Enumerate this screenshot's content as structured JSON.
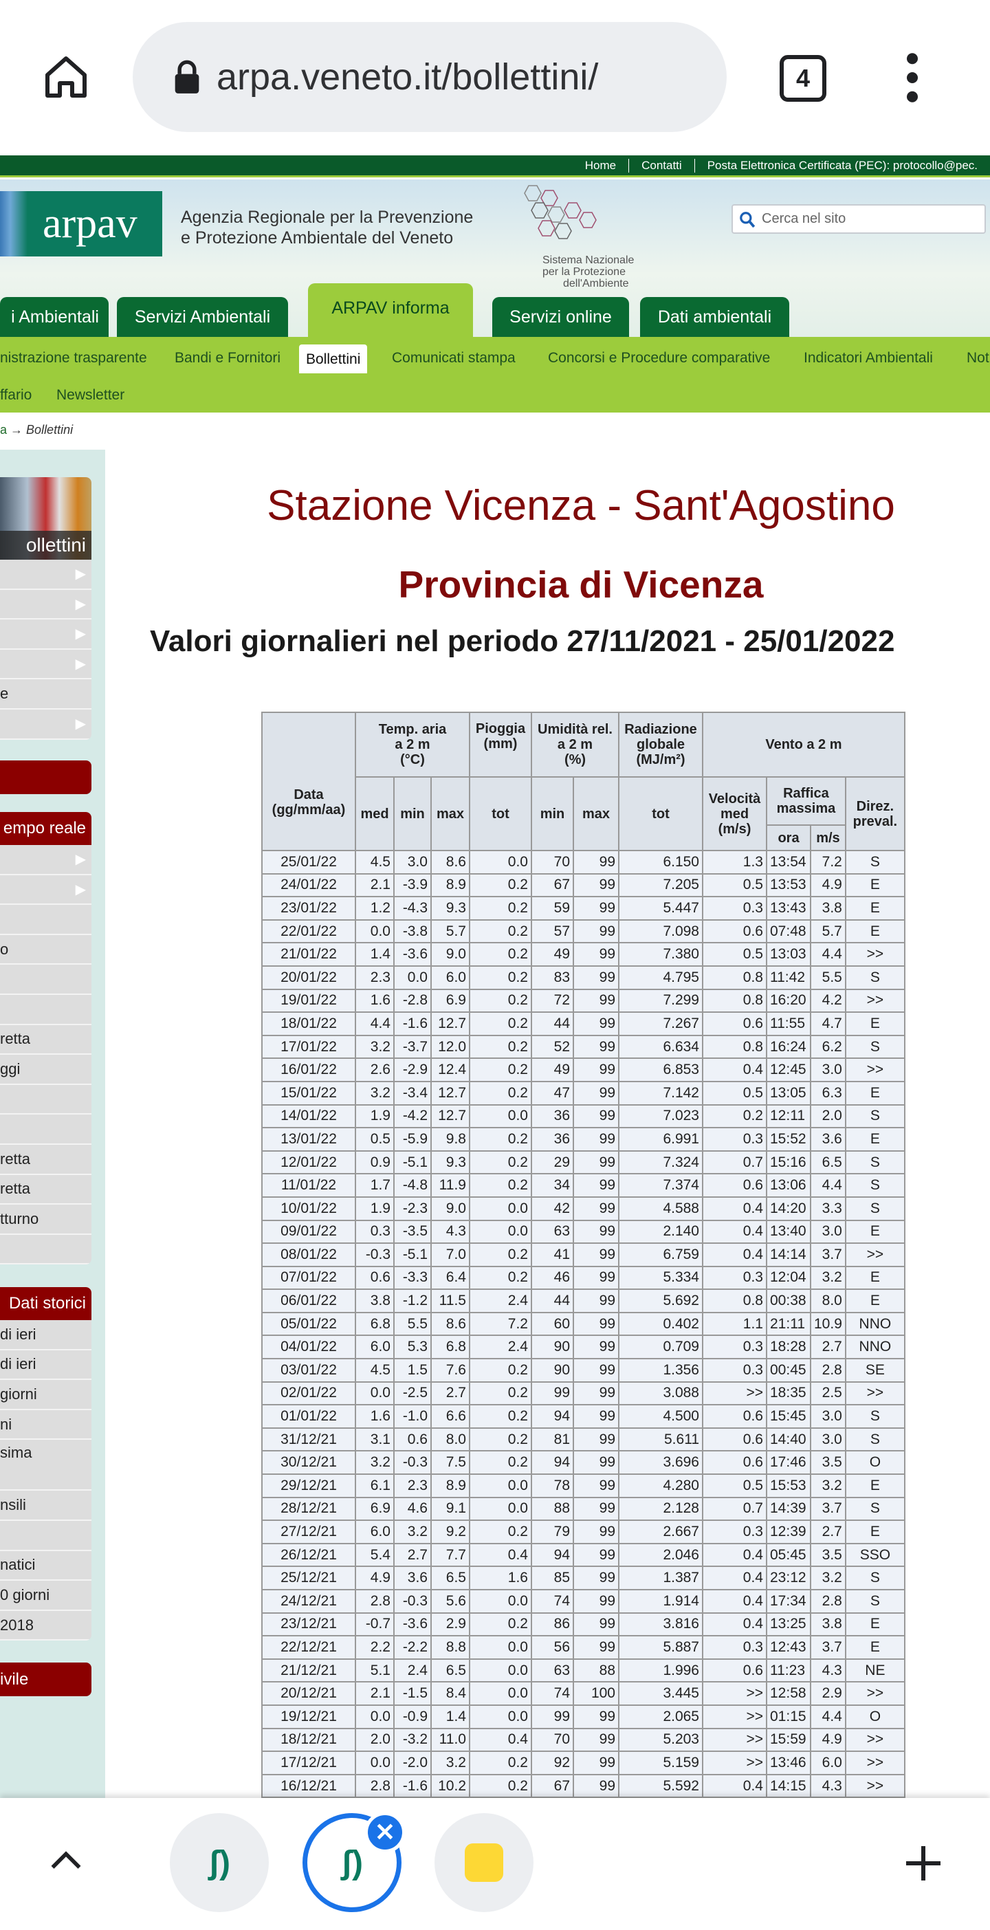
{
  "browser": {
    "url": "arpa.veneto.it/bollettini/",
    "tab_count": "4"
  },
  "topbar": {
    "links": [
      "Home",
      "Contatti",
      "Posta Elettronica Certificata (PEC): protocollo@pec."
    ]
  },
  "header": {
    "logo_text": "arpav",
    "agency_line1": "Agenzia Regionale per la Prevenzione",
    "agency_line2": "e Protezione Ambientale del Veneto",
    "snpa_line1": "Sistema Nazionale",
    "snpa_line2": "per la Protezione",
    "snpa_line3": "dell'Ambiente",
    "search_placeholder": "Cerca nel sito"
  },
  "tabs": [
    "i Ambientali",
    "Servizi Ambientali",
    "ARPAV informa",
    "Servizi online",
    "Dati ambientali"
  ],
  "subnav": {
    "row1": [
      "nistrazione trasparente",
      "Bandi e Fornitori",
      "Bollettini",
      "Comunicati stampa",
      "Concorsi e Procedure comparative",
      "Indicatori Ambientali",
      "Not"
    ],
    "row2": [
      "ffario",
      "Newsletter"
    ]
  },
  "breadcrumb": {
    "current": "Bollettini"
  },
  "sidebar": {
    "box1_title": "ollettini",
    "box1_items": [
      "",
      "",
      "",
      "",
      "e",
      ""
    ],
    "box2_title": "empo reale",
    "box2_items": [
      "",
      "",
      "",
      "o",
      "",
      "",
      "retta",
      "ggi",
      "",
      "",
      "retta",
      "retta",
      "tturno",
      ""
    ],
    "box3_title": "Dati storici",
    "box3_items": [
      "di ieri",
      "di ieri",
      "giorni",
      "ni",
      "sima",
      "nsili",
      "",
      "natici",
      "0 giorni",
      "2018"
    ],
    "box4_title": "ivile"
  },
  "main": {
    "title": "Stazione Vicenza - Sant'Agostino",
    "subtitle": "Provincia di Vicenza",
    "period": "Valori giornalieri nel periodo 27/11/2021 - 25/01/2022"
  },
  "table": {
    "headers": {
      "data": "Data",
      "data_unit": "(gg/mm/aa)",
      "temp": "Temp. aria",
      "temp2": "a 2 m",
      "temp3": "(°C)",
      "rain": "Pioggia",
      "rain2": "(mm)",
      "hum": "Umidità rel.",
      "hum2": "a 2 m",
      "hum3": "(%)",
      "rad": "Radiazione",
      "rad2": "globale",
      "rad3": "(MJ/m²)",
      "wind": "Vento a 2 m",
      "med": "med",
      "min": "min",
      "max": "max",
      "tot": "tot",
      "vel": "Velocità",
      "vel2": "med",
      "vel3": "(m/s)",
      "gust": "Raffica",
      "gust2": "massima",
      "ora": "ora",
      "ms": "m/s",
      "dir": "Direz.",
      "dir2": "preval."
    },
    "rows": [
      [
        "25/01/22",
        "4.5",
        "3.0",
        "8.6",
        "0.0",
        "70",
        "99",
        "6.150",
        "1.3",
        "13:54",
        "7.2",
        "S"
      ],
      [
        "24/01/22",
        "2.1",
        "-3.9",
        "8.9",
        "0.2",
        "67",
        "99",
        "7.205",
        "0.5",
        "13:53",
        "4.9",
        "E"
      ],
      [
        "23/01/22",
        "1.2",
        "-4.3",
        "9.3",
        "0.2",
        "59",
        "99",
        "5.447",
        "0.3",
        "13:43",
        "3.8",
        "E"
      ],
      [
        "22/01/22",
        "0.0",
        "-3.8",
        "5.7",
        "0.2",
        "57",
        "99",
        "7.098",
        "0.6",
        "07:48",
        "5.7",
        "E"
      ],
      [
        "21/01/22",
        "1.4",
        "-3.6",
        "9.0",
        "0.2",
        "49",
        "99",
        "7.380",
        "0.5",
        "13:03",
        "4.4",
        ">>"
      ],
      [
        "20/01/22",
        "2.3",
        "0.0",
        "6.0",
        "0.2",
        "83",
        "99",
        "4.795",
        "0.8",
        "11:42",
        "5.5",
        "S"
      ],
      [
        "19/01/22",
        "1.6",
        "-2.8",
        "6.9",
        "0.2",
        "72",
        "99",
        "7.299",
        "0.8",
        "16:20",
        "4.2",
        ">>"
      ],
      [
        "18/01/22",
        "4.4",
        "-1.6",
        "12.7",
        "0.2",
        "44",
        "99",
        "7.267",
        "0.6",
        "11:55",
        "4.7",
        "E"
      ],
      [
        "17/01/22",
        "3.2",
        "-3.7",
        "12.0",
        "0.2",
        "52",
        "99",
        "6.634",
        "0.8",
        "16:24",
        "6.2",
        "S"
      ],
      [
        "16/01/22",
        "2.6",
        "-2.9",
        "12.4",
        "0.2",
        "49",
        "99",
        "6.853",
        "0.4",
        "12:45",
        "3.0",
        ">>"
      ],
      [
        "15/01/22",
        "3.2",
        "-3.4",
        "12.7",
        "0.2",
        "47",
        "99",
        "7.142",
        "0.5",
        "13:05",
        "6.3",
        "E"
      ],
      [
        "14/01/22",
        "1.9",
        "-4.2",
        "12.7",
        "0.0",
        "36",
        "99",
        "7.023",
        "0.2",
        "12:11",
        "2.0",
        "S"
      ],
      [
        "13/01/22",
        "0.5",
        "-5.9",
        "9.8",
        "0.2",
        "36",
        "99",
        "6.991",
        "0.3",
        "15:52",
        "3.6",
        "E"
      ],
      [
        "12/01/22",
        "0.9",
        "-5.1",
        "9.3",
        "0.2",
        "29",
        "99",
        "7.324",
        "0.7",
        "15:16",
        "6.5",
        "S"
      ],
      [
        "11/01/22",
        "1.7",
        "-4.8",
        "11.9",
        "0.2",
        "34",
        "99",
        "7.374",
        "0.6",
        "13:06",
        "4.4",
        "S"
      ],
      [
        "10/01/22",
        "1.9",
        "-2.3",
        "9.0",
        "0.0",
        "42",
        "99",
        "4.588",
        "0.4",
        "14:20",
        "3.3",
        "S"
      ],
      [
        "09/01/22",
        "0.3",
        "-3.5",
        "4.3",
        "0.0",
        "63",
        "99",
        "2.140",
        "0.4",
        "13:40",
        "3.0",
        "E"
      ],
      [
        "08/01/22",
        "-0.3",
        "-5.1",
        "7.0",
        "0.2",
        "41",
        "99",
        "6.759",
        "0.4",
        "14:14",
        "3.7",
        ">>"
      ],
      [
        "07/01/22",
        "0.6",
        "-3.3",
        "6.4",
        "0.2",
        "46",
        "99",
        "5.334",
        "0.3",
        "12:04",
        "3.2",
        "E"
      ],
      [
        "06/01/22",
        "3.8",
        "-1.2",
        "11.5",
        "2.4",
        "44",
        "99",
        "5.692",
        "0.8",
        "00:38",
        "8.0",
        "E"
      ],
      [
        "05/01/22",
        "6.8",
        "5.5",
        "8.6",
        "7.2",
        "60",
        "99",
        "0.402",
        "1.1",
        "21:11",
        "10.9",
        "NNO"
      ],
      [
        "04/01/22",
        "6.0",
        "5.3",
        "6.8",
        "2.4",
        "90",
        "99",
        "0.709",
        "0.3",
        "18:28",
        "2.7",
        "NNO"
      ],
      [
        "03/01/22",
        "4.5",
        "1.5",
        "7.6",
        "0.2",
        "90",
        "99",
        "1.356",
        "0.3",
        "00:45",
        "2.8",
        "SE"
      ],
      [
        "02/01/22",
        "0.0",
        "-2.5",
        "2.7",
        "0.2",
        "99",
        "99",
        "3.088",
        ">>",
        "18:35",
        "2.5",
        ">>"
      ],
      [
        "01/01/22",
        "1.6",
        "-1.0",
        "6.6",
        "0.2",
        "94",
        "99",
        "4.500",
        "0.6",
        "15:45",
        "3.0",
        "S"
      ],
      [
        "31/12/21",
        "3.1",
        "0.6",
        "8.0",
        "0.2",
        "81",
        "99",
        "5.611",
        "0.6",
        "14:40",
        "3.0",
        "S"
      ],
      [
        "30/12/21",
        "3.2",
        "-0.3",
        "7.5",
        "0.2",
        "94",
        "99",
        "3.696",
        "0.6",
        "17:46",
        "3.5",
        "O"
      ],
      [
        "29/12/21",
        "6.1",
        "2.3",
        "8.9",
        "0.0",
        "78",
        "99",
        "4.280",
        "0.5",
        "15:53",
        "3.2",
        "E"
      ],
      [
        "28/12/21",
        "6.9",
        "4.6",
        "9.1",
        "0.0",
        "88",
        "99",
        "2.128",
        "0.7",
        "14:39",
        "3.7",
        "S"
      ],
      [
        "27/12/21",
        "6.0",
        "3.2",
        "9.2",
        "0.2",
        "79",
        "99",
        "2.667",
        "0.3",
        "12:39",
        "2.7",
        "E"
      ],
      [
        "26/12/21",
        "5.4",
        "2.7",
        "7.7",
        "0.4",
        "94",
        "99",
        "2.046",
        "0.4",
        "05:45",
        "3.5",
        "SSO"
      ],
      [
        "25/12/21",
        "4.9",
        "3.6",
        "6.5",
        "1.6",
        "85",
        "99",
        "1.387",
        "0.4",
        "23:12",
        "3.2",
        "S"
      ],
      [
        "24/12/21",
        "2.8",
        "-0.3",
        "5.6",
        "0.0",
        "74",
        "99",
        "1.914",
        "0.4",
        "17:34",
        "2.8",
        "S"
      ],
      [
        "23/12/21",
        "-0.7",
        "-3.6",
        "2.9",
        "0.2",
        "86",
        "99",
        "3.816",
        "0.4",
        "13:25",
        "3.8",
        "E"
      ],
      [
        "22/12/21",
        "2.2",
        "-2.2",
        "8.8",
        "0.0",
        "56",
        "99",
        "5.887",
        "0.3",
        "12:43",
        "3.7",
        "E"
      ],
      [
        "21/12/21",
        "5.1",
        "2.4",
        "6.5",
        "0.0",
        "63",
        "88",
        "1.996",
        "0.6",
        "11:23",
        "4.3",
        "NE"
      ],
      [
        "20/12/21",
        "2.1",
        "-1.5",
        "8.4",
        "0.0",
        "74",
        "100",
        "3.445",
        ">>",
        "12:58",
        "2.9",
        ">>"
      ],
      [
        "19/12/21",
        "0.0",
        "-0.9",
        "1.4",
        "0.0",
        "99",
        "99",
        "2.065",
        ">>",
        "01:15",
        "4.4",
        "O"
      ],
      [
        "18/12/21",
        "2.0",
        "-3.2",
        "11.0",
        "0.4",
        "70",
        "99",
        "5.203",
        ">>",
        "15:59",
        "4.9",
        ">>"
      ],
      [
        "17/12/21",
        "0.0",
        "-2.0",
        "3.2",
        "0.2",
        "92",
        "99",
        "5.159",
        ">>",
        "13:46",
        "6.0",
        ">>"
      ],
      [
        "16/12/21",
        "2.8",
        "-1.6",
        "10.2",
        "0.2",
        "67",
        "99",
        "5.592",
        "0.4",
        "14:15",
        "4.3",
        ">>"
      ]
    ]
  },
  "colors": {
    "dark_green": "#0a5a2a",
    "lime": "#9ccc3c",
    "maroon": "#7f0a0a",
    "sidebar_bg": "#d6eae7"
  }
}
